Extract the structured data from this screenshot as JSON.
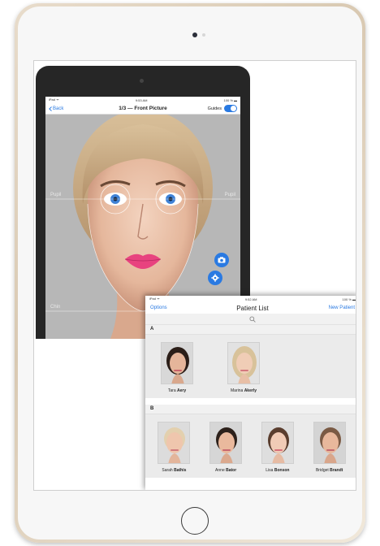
{
  "back_screen": {
    "status_left": "iPad ᯤ",
    "status_center": "9:53 AM",
    "status_right": "100 % ▬",
    "back_label": "Back",
    "title": "1/3 — Front Picture",
    "guides_label": "Guides",
    "guides_on": true,
    "labels": {
      "pupil_left": "Pupil",
      "pupil_right": "Pupil",
      "chin": "Chin"
    }
  },
  "patient_list": {
    "status_left": "iPad ᯤ",
    "status_center": "9:52 AM",
    "status_right": "100 % ▬",
    "options_label": "Options",
    "title": "Patient List",
    "new_patient_label": "New Patient",
    "sections": [
      {
        "letter": "A",
        "patients": [
          {
            "first": "Tara",
            "last": "Aery"
          },
          {
            "first": "Marina",
            "last": "Akerly"
          }
        ]
      },
      {
        "letter": "B",
        "patients": [
          {
            "first": "Sarah",
            "last": "Bathis"
          },
          {
            "first": "Anne",
            "last": "Bator"
          },
          {
            "first": "Lisa",
            "last": "Bonson"
          },
          {
            "first": "Bridget",
            "last": "Brandt"
          }
        ]
      }
    ]
  },
  "colors": {
    "accent": "#2a7ae2",
    "device_gold": "#d9c9b2"
  }
}
